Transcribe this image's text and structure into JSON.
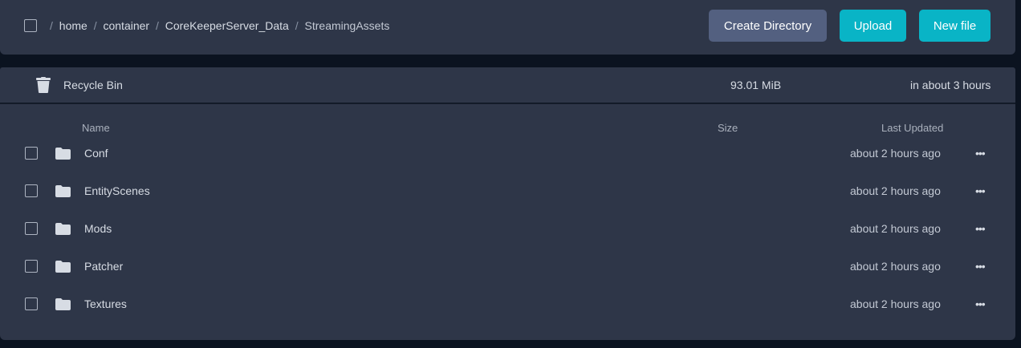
{
  "breadcrumb": {
    "segments": [
      "home",
      "container",
      "CoreKeeperServer_Data",
      "StreamingAssets"
    ]
  },
  "toolbar": {
    "create_directory": "Create Directory",
    "upload": "Upload",
    "new_file": "New file"
  },
  "colors": {
    "panel": "#2e3648",
    "background": "#0b1320",
    "accent": "#09b4c6",
    "secondary_button": "#536080"
  },
  "recycle_bin": {
    "label": "Recycle Bin",
    "size": "93.01 MiB",
    "expiry": "in about 3 hours",
    "icon": "trash-icon"
  },
  "columns": {
    "name": "Name",
    "size": "Size",
    "last_updated": "Last Updated"
  },
  "files": [
    {
      "name": "Conf",
      "updated": "about 2 hours ago",
      "icon": "folder-icon"
    },
    {
      "name": "EntityScenes",
      "updated": "about 2 hours ago",
      "icon": "folder-icon"
    },
    {
      "name": "Mods",
      "updated": "about 2 hours ago",
      "icon": "folder-icon"
    },
    {
      "name": "Patcher",
      "updated": "about 2 hours ago",
      "icon": "folder-icon"
    },
    {
      "name": "Textures",
      "updated": "about 2 hours ago",
      "icon": "folder-icon"
    }
  ],
  "row_menu": "•••"
}
